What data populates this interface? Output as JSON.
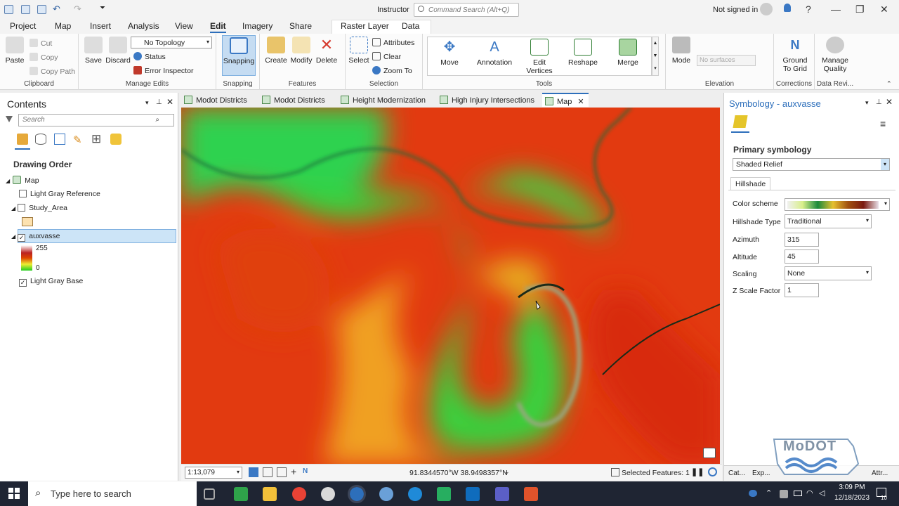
{
  "titlebar": {
    "title": "Instructor",
    "command_search_placeholder": "Command Search (Alt+Q)",
    "signin": "Not signed in"
  },
  "ribbon_tabs": [
    "Project",
    "Map",
    "Insert",
    "Analysis",
    "View",
    "Edit",
    "Imagery",
    "Share",
    "Raster Layer",
    "Data"
  ],
  "active_tab": "Edit",
  "ribbon": {
    "clipboard": {
      "paste": "Paste",
      "cut": "Cut",
      "copy": "Copy",
      "copy_path": "Copy Path",
      "label": "Clipboard"
    },
    "manage_edits": {
      "save": "Save",
      "discard": "Discard",
      "topology": "No Topology",
      "status": "Status",
      "error_inspector": "Error Inspector",
      "label": "Manage Edits"
    },
    "snapping": {
      "snapping": "Snapping",
      "label": "Snapping"
    },
    "features": {
      "create": "Create",
      "modify": "Modify",
      "delete": "Delete",
      "label": "Features"
    },
    "selection": {
      "select": "Select",
      "attributes": "Attributes",
      "clear": "Clear",
      "zoom_to": "Zoom To",
      "label": "Selection"
    },
    "tools": {
      "move": "Move",
      "annotation": "Annotation",
      "edit_vertices": "Edit Vertices",
      "reshape": "Reshape",
      "merge": "Merge",
      "label": "Tools"
    },
    "elevation": {
      "mode": "Mode",
      "surfaces": "No surfaces",
      "label": "Elevation"
    },
    "corrections": {
      "ground_to_grid": "Ground To Grid",
      "label": "Corrections"
    },
    "data_reviewer": {
      "manage_quality": "Manage Quality",
      "label": "Data Revi..."
    }
  },
  "contents": {
    "title": "Contents",
    "search_placeholder": "Search",
    "drawing_order": "Drawing Order",
    "layers": {
      "map": "Map",
      "light_gray_reference": "Light Gray Reference",
      "study_area": "Study_Area",
      "auxvasse": "auxvasse",
      "legend_high": "255",
      "legend_low": "0",
      "light_gray_base": "Light Gray Base"
    }
  },
  "map_tabs": [
    "Modot Districts",
    "Modot Districts",
    "Height Modernization",
    "High Injury Intersections",
    "Map"
  ],
  "statusbar": {
    "scale": "1:13,079",
    "coordinates": "91.8344570°W 38.9498357°N",
    "selected": "Selected Features: 1"
  },
  "symbology": {
    "title": "Symbology - auxvasse",
    "primary_label": "Primary symbology",
    "primary_value": "Shaded Relief",
    "tab": "Hillshade",
    "fields": {
      "color_scheme": "Color scheme",
      "hillshade_type_label": "Hillshade Type",
      "hillshade_type": "Traditional",
      "azimuth_label": "Azimuth",
      "azimuth": "315",
      "altitude_label": "Altitude",
      "altitude": "45",
      "scaling_label": "Scaling",
      "scaling": "None",
      "z_label": "Z Scale Factor",
      "z": "1"
    },
    "bottom_tabs": [
      "Cat...",
      "Exp...",
      "Attr..."
    ]
  },
  "watermark": "MoDOT",
  "taskbar": {
    "search": "Type here to search",
    "time": "3:09 PM",
    "date": "12/18/2023",
    "notif": "10"
  }
}
